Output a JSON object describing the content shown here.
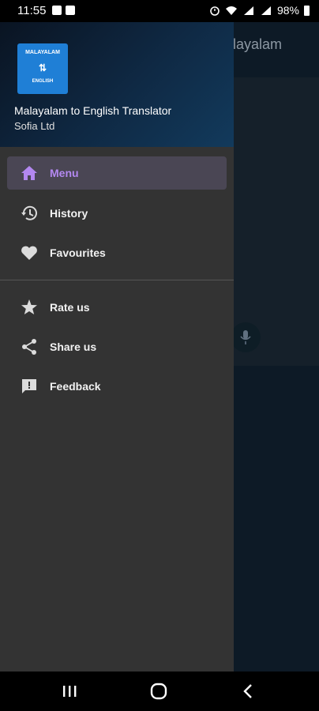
{
  "status_bar": {
    "time": "11:55",
    "battery": "98%"
  },
  "background_app": {
    "title_fragment": "alayalam"
  },
  "drawer": {
    "logo": {
      "line1": "MALAYALAM",
      "line2": "⇅",
      "line3": "ENGLISH"
    },
    "app_name": "Malayalam to English Translator",
    "company": "Sofia Ltd",
    "items": [
      {
        "label": "Menu",
        "icon": "home-icon",
        "active": true
      },
      {
        "label": "History",
        "icon": "history-icon",
        "active": false
      },
      {
        "label": "Favourites",
        "icon": "heart-icon",
        "active": false
      },
      {
        "label": "Rate us",
        "icon": "star-icon",
        "active": false
      },
      {
        "label": "Share us",
        "icon": "share-icon",
        "active": false
      },
      {
        "label": "Feedback",
        "icon": "feedback-icon",
        "active": false
      }
    ]
  },
  "colors": {
    "accent": "#b388f0",
    "drawer_bg": "#333333",
    "logo_bg": "#1f7fd6"
  }
}
